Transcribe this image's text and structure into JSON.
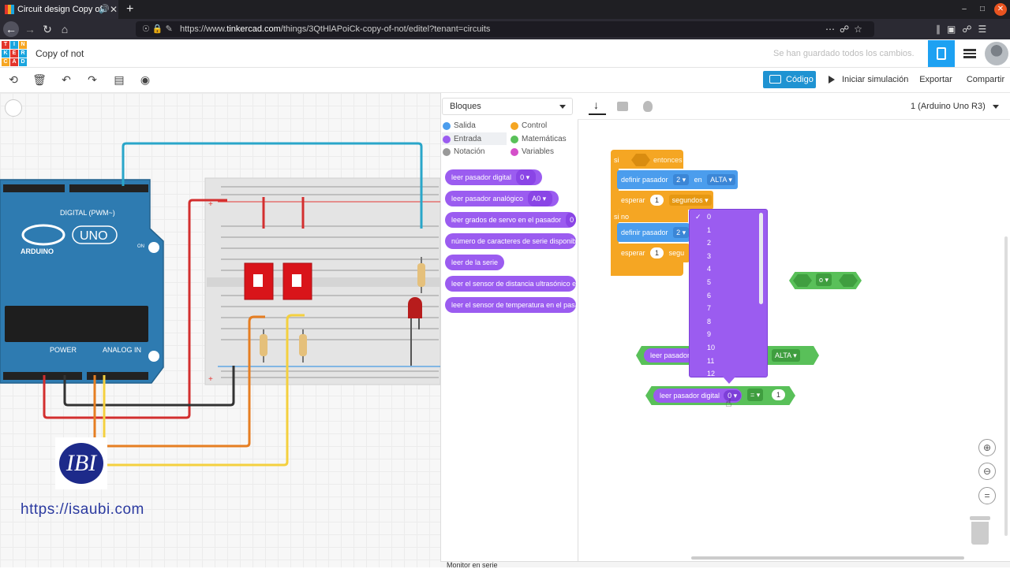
{
  "browser": {
    "tab_title": "Circuit design Copy of",
    "url_prefix": "https://www.",
    "url_host": "tinkercad.com",
    "url_path": "/things/3QtHlAPoiCk-copy-of-not/editel?tenant=circuits"
  },
  "header": {
    "logo_letters": [
      "T",
      "I",
      "N",
      "K",
      "E",
      "R",
      "C",
      "A",
      "D"
    ],
    "title": "Copy of not",
    "save_status": "Se han guardado todos los cambios."
  },
  "toolbar": {
    "code_label": "Código",
    "simulate_label": "Iniciar simulación",
    "export_label": "Exportar",
    "share_label": "Compartir"
  },
  "palette": {
    "dropdown_label": "Bloques",
    "categories": [
      {
        "label": "Salida",
        "color": "#4b9ded"
      },
      {
        "label": "Control",
        "color": "#f5a623"
      },
      {
        "label": "Entrada",
        "color": "#9b5cf0"
      },
      {
        "label": "Matemáticas",
        "color": "#59c059"
      },
      {
        "label": "Notación",
        "color": "#999999"
      },
      {
        "label": "Variables",
        "color": "#d44fc9"
      }
    ],
    "blocks": [
      {
        "label": "leer pasador digital",
        "value": "0"
      },
      {
        "label": "leer pasador analógico",
        "value": "A0"
      },
      {
        "label": "leer grados de servo en el pasador",
        "value": "0"
      },
      {
        "label": "número de caracteres de serie disponibles",
        "value": ""
      },
      {
        "label": "leer de la serie",
        "value": ""
      },
      {
        "label": "leer el sensor de distancia ultrasónico en el",
        "value": ""
      },
      {
        "label": "leer el sensor de temperatura en el pasador",
        "value": ""
      }
    ]
  },
  "workspace": {
    "device": "1 (Arduino Uno R3)",
    "if_label": "si",
    "then_label": "entonces",
    "else_label": "si no",
    "set_pin_label": "definir pasador",
    "set_pin_value": "2",
    "to_label": "en",
    "high_value": "ALTA",
    "wait_label": "esperar",
    "wait_value": "1",
    "wait_unit": "segundos",
    "wait_unit_short": "segu",
    "or_value": "o",
    "read_pin_label": "leer pasador",
    "read_pin_full": "leer pasador digital",
    "read_pin_value": "0",
    "compare_op": "=",
    "compare_value": "1",
    "dropdown_options": [
      "0",
      "1",
      "2",
      "3",
      "4",
      "5",
      "6",
      "7",
      "8",
      "9",
      "10",
      "11",
      "12"
    ],
    "selected_option": "0"
  },
  "serial_label": "Monitor en serie",
  "board_labels": {
    "digital": "DIGITAL (PWM~)",
    "arduino": "ARDUINO",
    "uno": "UNO",
    "on": "ON",
    "power": "POWER",
    "analog_in": "ANALOG IN"
  },
  "watermark": {
    "logo_text": "IBI",
    "url": "https://isaubi.com"
  }
}
